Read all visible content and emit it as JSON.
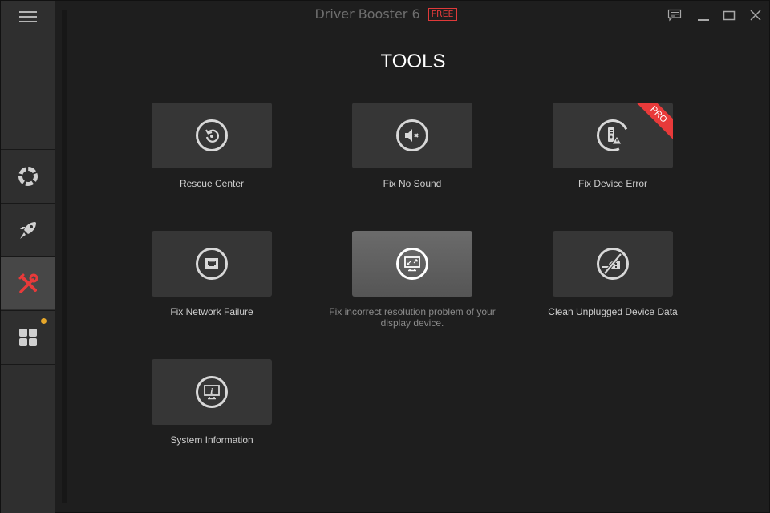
{
  "window": {
    "title": "Driver Booster 6",
    "edition_badge": "FREE",
    "controls": [
      "feedback-icon",
      "minimize-icon",
      "maximize-icon",
      "close-icon"
    ]
  },
  "sidebar": {
    "menu_icon": "hamburger-icon",
    "items": [
      {
        "id": "rescue",
        "icon": "lifebuoy-icon",
        "active": false
      },
      {
        "id": "boost",
        "icon": "rocket-icon",
        "active": false
      },
      {
        "id": "tools",
        "icon": "tools-icon",
        "active": true
      },
      {
        "id": "action-center",
        "icon": "apps-grid-icon",
        "active": false,
        "notification_dot": true
      }
    ]
  },
  "main": {
    "heading": "TOOLS",
    "tools": [
      {
        "label": "Rescue Center",
        "icon": "restore-icon"
      },
      {
        "label": "Fix No Sound",
        "icon": "mute-speaker-icon"
      },
      {
        "label": "Fix Device Error",
        "icon": "device-warning-icon",
        "badge": "PRO"
      },
      {
        "label": "Fix Network Failure",
        "icon": "ethernet-port-icon"
      },
      {
        "label": "Fix incorrect resolution problem of your display device.",
        "icon": "monitor-resize-icon",
        "hovered": true
      },
      {
        "label": "Clean Unplugged Device Data",
        "icon": "unplugged-usb-icon"
      },
      {
        "label": "System Information",
        "icon": "monitor-info-icon"
      }
    ]
  },
  "colors": {
    "accent_red": "#e83a3a",
    "notification_dot": "#e6a72a",
    "background": "#1e1e1e",
    "sidebar": "#2f2f2f"
  }
}
